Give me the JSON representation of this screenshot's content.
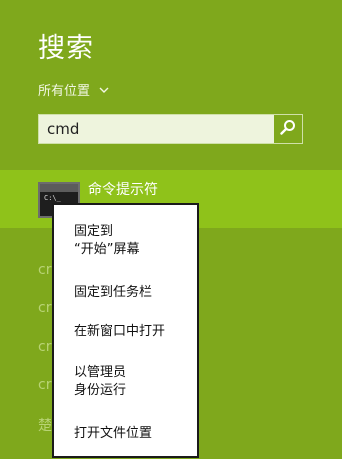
{
  "search_pane": {
    "title": "搜索",
    "scope_label": "所有位置",
    "query": "cmd",
    "bg_color": "#7fa81c",
    "highlight_color": "#8fc21a"
  },
  "selected_result": {
    "icon": "command-prompt-icon",
    "icon_text": "C:\\_",
    "name": "命令提示符"
  },
  "background_results": [
    {
      "label": "cr"
    },
    {
      "label": "cr"
    },
    {
      "label": "cr"
    },
    {
      "label": "cr"
    },
    {
      "label": "楚"
    }
  ],
  "context_menu": {
    "items": [
      {
        "lines": [
          "固定到",
          "“开始”屏幕"
        ]
      },
      {
        "lines": [
          "固定到任务栏"
        ]
      },
      {
        "lines": [
          "在新窗口中打开"
        ]
      },
      {
        "lines": [
          "以管理员",
          "身份运行"
        ]
      },
      {
        "lines": [
          "打开文件位置"
        ]
      }
    ]
  }
}
